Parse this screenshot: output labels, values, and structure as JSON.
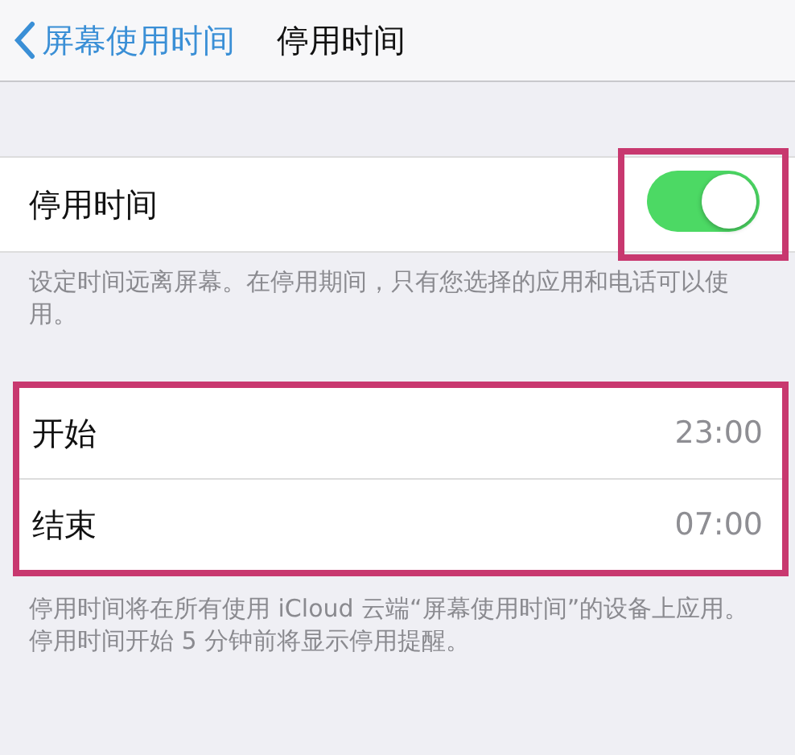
{
  "nav": {
    "back_label": "屏幕使用时间",
    "title": "停用时间"
  },
  "downtime": {
    "label": "停用时间",
    "on": true,
    "highlighted": true
  },
  "description": "设定时间远离屏幕。在停用期间，只有您选择的应用和电话可以使用。",
  "schedule": {
    "highlighted": true,
    "rows": [
      {
        "label": "开始",
        "value": "23:00"
      },
      {
        "label": "结束",
        "value": "07:00"
      }
    ]
  },
  "footer": "停用时间将在所有使用 iCloud 云端“屏幕使用时间”的设备上应用。停用时间开始 5 分钟前将显示停用提醒。"
}
